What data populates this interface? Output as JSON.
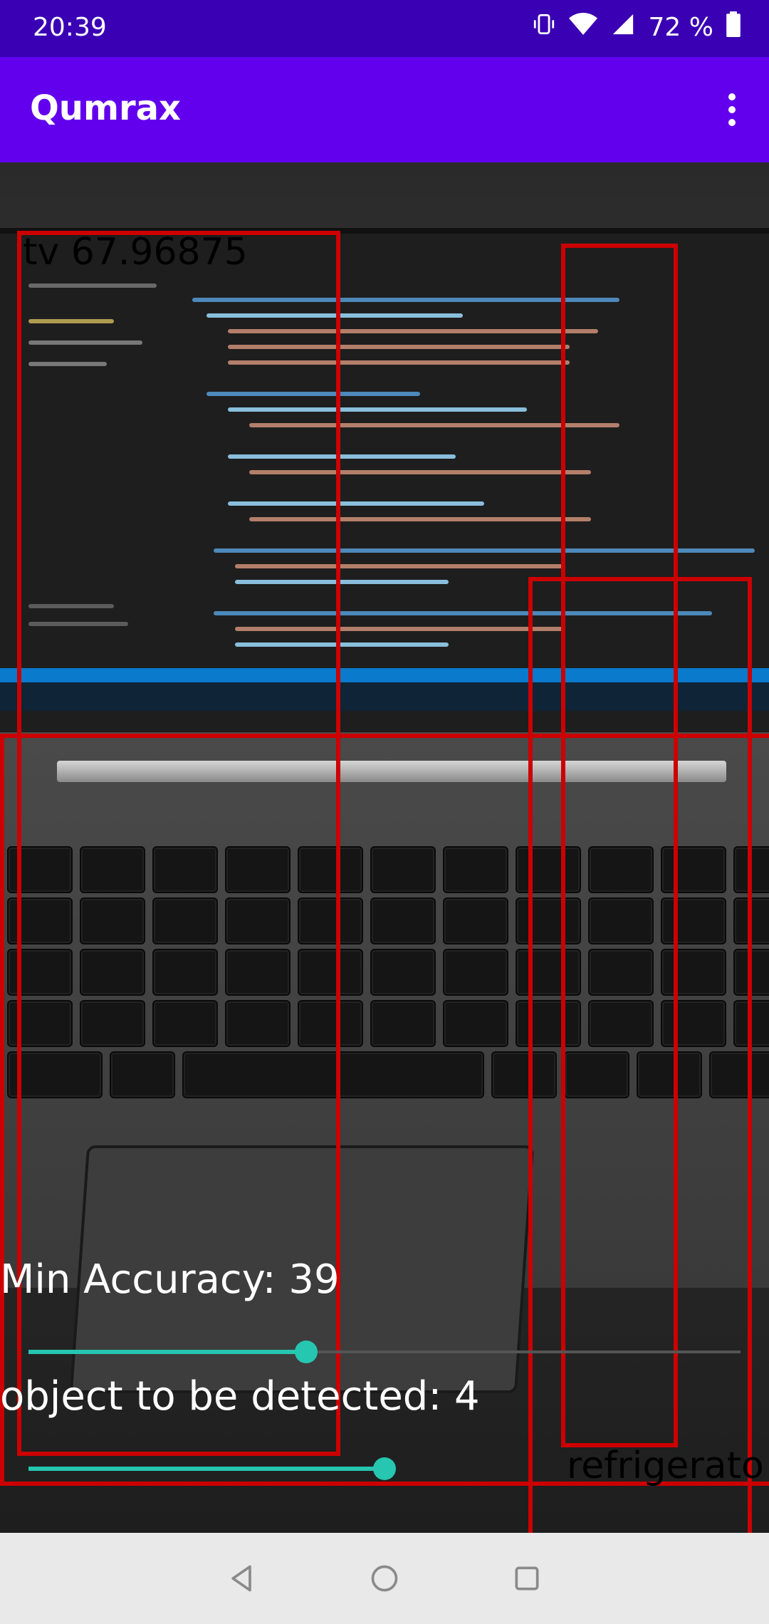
{
  "status_bar": {
    "time": "20:39",
    "battery": "72 %"
  },
  "app_bar": {
    "title": "Qumrax"
  },
  "detections": [
    {
      "label": "tv 67.96875"
    },
    {
      "label": "refrigerato"
    }
  ],
  "controls": {
    "min_accuracy": {
      "label": "Min Accuracy: 39",
      "value_fraction": 0.39
    },
    "objects": {
      "label": "object to be detected: 4",
      "value_fraction": 0.5
    }
  },
  "colors": {
    "status_bar": "#3a00b4",
    "app_bar": "#6200ee",
    "box": "#cc0000",
    "slider_accent": "#26c6b0"
  },
  "nav_bar": {
    "icons": [
      "back-icon",
      "home-icon",
      "recents-icon"
    ]
  }
}
